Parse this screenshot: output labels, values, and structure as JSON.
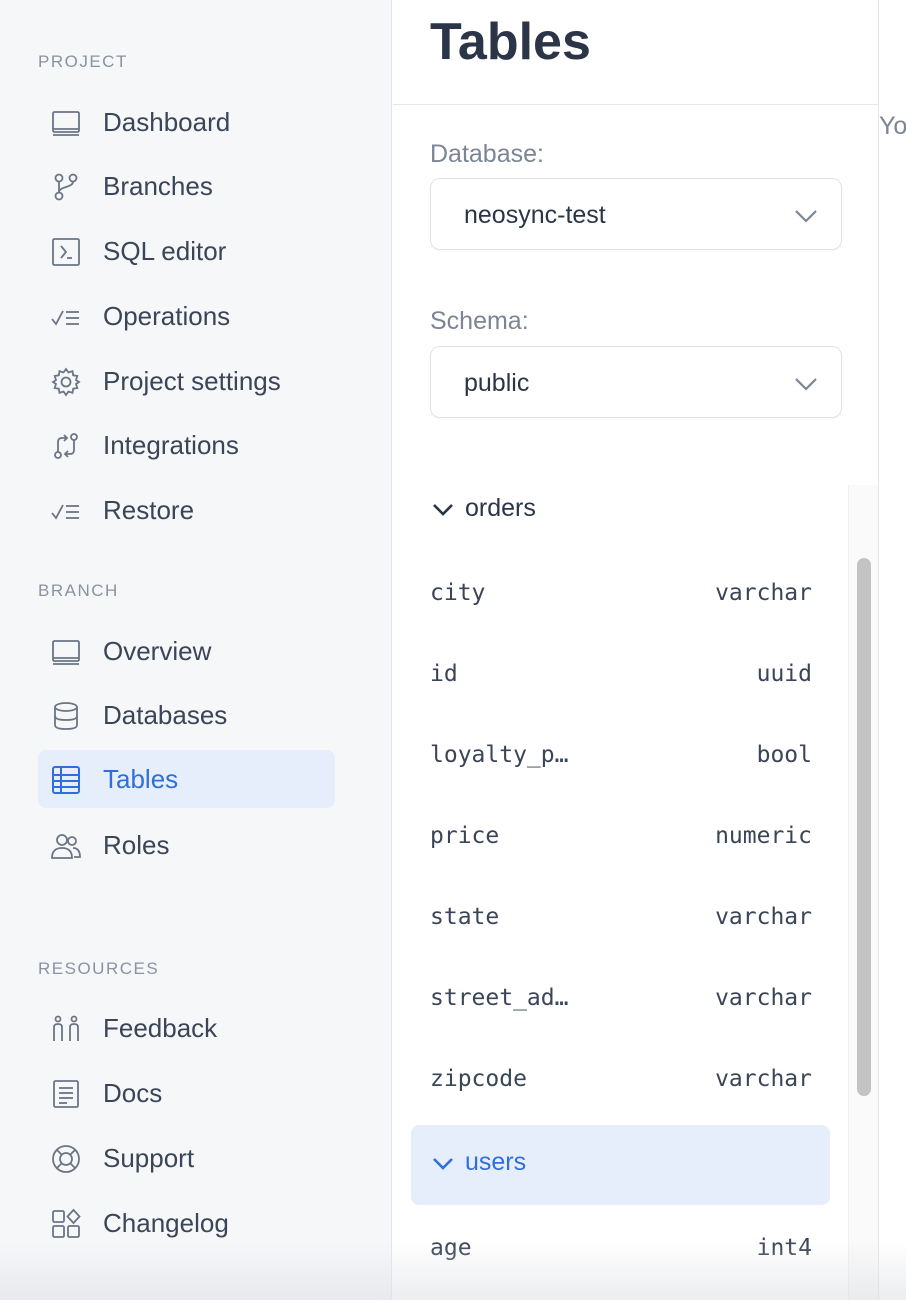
{
  "sidebar": {
    "sections": [
      {
        "label": "PROJECT"
      },
      {
        "label": "BRANCH"
      },
      {
        "label": "RESOURCES"
      }
    ],
    "project_items": [
      {
        "label": "Dashboard",
        "icon": "dashboard-icon"
      },
      {
        "label": "Branches",
        "icon": "branch-icon"
      },
      {
        "label": "SQL editor",
        "icon": "sql-editor-icon"
      },
      {
        "label": "Operations",
        "icon": "operations-icon"
      },
      {
        "label": "Project settings",
        "icon": "gear-icon"
      },
      {
        "label": "Integrations",
        "icon": "integrations-icon"
      },
      {
        "label": "Restore",
        "icon": "restore-icon"
      }
    ],
    "branch_items": [
      {
        "label": "Overview",
        "icon": "overview-icon"
      },
      {
        "label": "Databases",
        "icon": "database-icon"
      },
      {
        "label": "Tables",
        "icon": "table-icon",
        "active": true
      },
      {
        "label": "Roles",
        "icon": "users-icon"
      }
    ],
    "resource_items": [
      {
        "label": "Feedback",
        "icon": "feedback-icon"
      },
      {
        "label": "Docs",
        "icon": "docs-icon"
      },
      {
        "label": "Support",
        "icon": "lifebuoy-icon"
      },
      {
        "label": "Changelog",
        "icon": "changelog-icon"
      }
    ]
  },
  "main": {
    "title": "Tables",
    "database": {
      "label": "Database:",
      "value": "neosync-test"
    },
    "schema": {
      "label": "Schema:",
      "value": "public"
    },
    "tables": [
      {
        "name": "orders",
        "expanded": true,
        "columns": [
          {
            "name": "city",
            "type": "varchar"
          },
          {
            "name": "id",
            "type": "uuid"
          },
          {
            "name": "loyalty_p…",
            "type": "bool"
          },
          {
            "name": "price",
            "type": "numeric"
          },
          {
            "name": "state",
            "type": "varchar"
          },
          {
            "name": "street_ad…",
            "type": "varchar"
          },
          {
            "name": "zipcode",
            "type": "varchar"
          }
        ]
      },
      {
        "name": "users",
        "expanded": true,
        "active": true,
        "columns": [
          {
            "name": "age",
            "type": "int4"
          }
        ]
      }
    ]
  },
  "right_panel": {
    "peek_text": "Yo"
  },
  "colors": {
    "accent": "#2f6fdb",
    "active_bg": "#e7eefb",
    "sidebar_bg": "#f6f7f9",
    "text": "#3a4557"
  }
}
